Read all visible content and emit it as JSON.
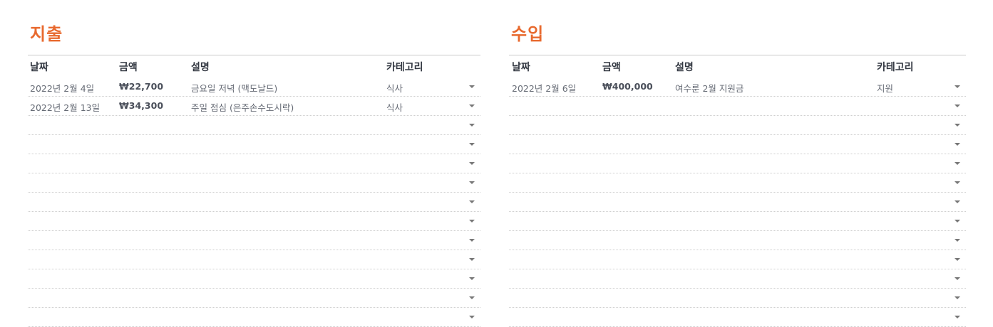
{
  "expenses": {
    "title": "지출",
    "headers": {
      "date": "날짜",
      "amount": "금액",
      "description": "설명",
      "category": "카테고리"
    },
    "rows": [
      {
        "date": "2022년  2월 4일",
        "amount": "₩22,700",
        "description": "금요일 저녁 (맥도날드)",
        "category": "식사"
      },
      {
        "date": "2022년  2월 13일",
        "amount": "₩34,300",
        "description": "주일 점심 (은주손수도시락)",
        "category": "식사"
      },
      {
        "date": "",
        "amount": "",
        "description": "",
        "category": ""
      },
      {
        "date": "",
        "amount": "",
        "description": "",
        "category": ""
      },
      {
        "date": "",
        "amount": "",
        "description": "",
        "category": ""
      },
      {
        "date": "",
        "amount": "",
        "description": "",
        "category": ""
      },
      {
        "date": "",
        "amount": "",
        "description": "",
        "category": ""
      },
      {
        "date": "",
        "amount": "",
        "description": "",
        "category": ""
      },
      {
        "date": "",
        "amount": "",
        "description": "",
        "category": ""
      },
      {
        "date": "",
        "amount": "",
        "description": "",
        "category": ""
      },
      {
        "date": "",
        "amount": "",
        "description": "",
        "category": ""
      },
      {
        "date": "",
        "amount": "",
        "description": "",
        "category": ""
      },
      {
        "date": "",
        "amount": "",
        "description": "",
        "category": ""
      }
    ]
  },
  "income": {
    "title": "수입",
    "headers": {
      "date": "날짜",
      "amount": "금액",
      "description": "설명",
      "category": "카테고리"
    },
    "rows": [
      {
        "date": "2022년  2월 6일",
        "amount": "₩400,000",
        "description": "여수룬 2월 지원금",
        "category": "지원"
      },
      {
        "date": "",
        "amount": "",
        "description": "",
        "category": ""
      },
      {
        "date": "",
        "amount": "",
        "description": "",
        "category": ""
      },
      {
        "date": "",
        "amount": "",
        "description": "",
        "category": ""
      },
      {
        "date": "",
        "amount": "",
        "description": "",
        "category": ""
      },
      {
        "date": "",
        "amount": "",
        "description": "",
        "category": ""
      },
      {
        "date": "",
        "amount": "",
        "description": "",
        "category": ""
      },
      {
        "date": "",
        "amount": "",
        "description": "",
        "category": ""
      },
      {
        "date": "",
        "amount": "",
        "description": "",
        "category": ""
      },
      {
        "date": "",
        "amount": "",
        "description": "",
        "category": ""
      },
      {
        "date": "",
        "amount": "",
        "description": "",
        "category": ""
      },
      {
        "date": "",
        "amount": "",
        "description": "",
        "category": ""
      },
      {
        "date": "",
        "amount": "",
        "description": "",
        "category": ""
      }
    ]
  },
  "colors": {
    "accent": "#e86a2f",
    "header_text": "#333842",
    "cell_text": "#666b75"
  }
}
